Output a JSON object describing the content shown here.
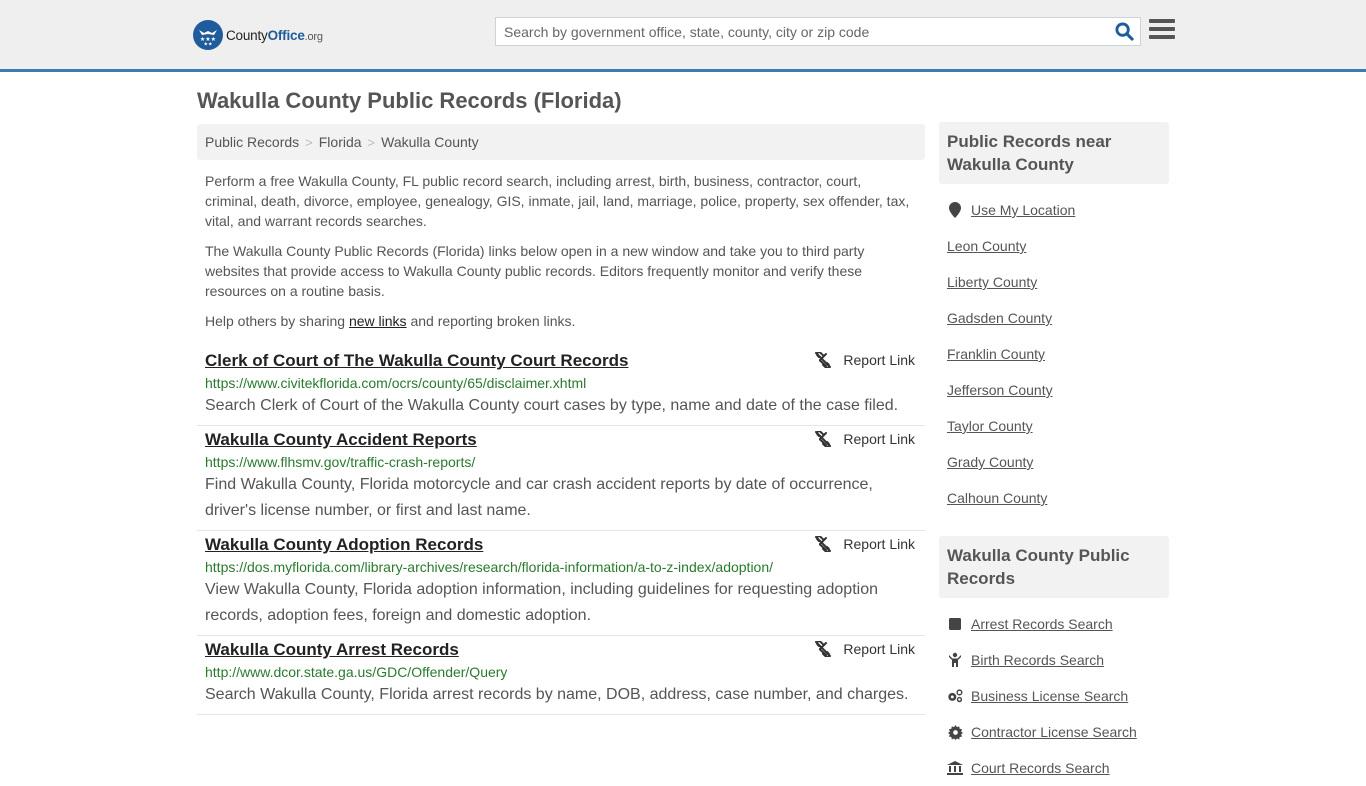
{
  "header": {
    "logo": {
      "name": "County",
      "office": "Office",
      "tld": ".org"
    },
    "search_placeholder": "Search by government office, state, county, city or zip code",
    "search_value": ""
  },
  "page": {
    "title": "Wakulla County Public Records (Florida)"
  },
  "breadcrumb": [
    "Public Records",
    "Florida",
    "Wakulla County"
  ],
  "intro": {
    "p1": "Perform a free Wakulla County, FL public record search, including arrest, birth, business, contractor, court, criminal, death, divorce, employee, genealogy, GIS, inmate, jail, land, marriage, police, property, sex offender, tax, vital, and warrant records searches.",
    "p2": "The Wakulla County Public Records (Florida) links below open in a new window and take you to third party websites that provide access to Wakulla County public records. Editors frequently monitor and verify these resources on a routine basis.",
    "p3_before": "Help others by sharing ",
    "p3_link": "new links",
    "p3_after": " and reporting broken links."
  },
  "report_label": "Report Link",
  "records": [
    {
      "title": "Clerk of Court of The Wakulla County Court Records",
      "url": "https://www.civitekflorida.com/ocrs/county/65/disclaimer.xhtml",
      "desc": "Search Clerk of Court of the Wakulla County court cases by type, name and date of the case filed."
    },
    {
      "title": "Wakulla County Accident Reports",
      "url": "https://www.flhsmv.gov/traffic-crash-reports/",
      "desc": "Find Wakulla County, Florida motorcycle and car crash accident reports by date of occurrence, driver's license number, or first and last name."
    },
    {
      "title": "Wakulla County Adoption Records",
      "url": "https://dos.myflorida.com/library-archives/research/florida-information/a-to-z-index/adoption/",
      "desc": "View Wakulla County, Florida adoption information, including guidelines for requesting adoption records, adoption fees, foreign and domestic adoption."
    },
    {
      "title": "Wakulla County Arrest Records",
      "url": "http://www.dcor.state.ga.us/GDC/Offender/Query",
      "desc": "Search Wakulla County, Florida arrest records by name, DOB, address, case number, and charges."
    }
  ],
  "sidebar": {
    "near_title": "Public Records near Wakulla County",
    "use_location": "Use My Location",
    "nearby": [
      "Leon County",
      "Liberty County",
      "Gadsden County",
      "Franklin County",
      "Jefferson County",
      "Taylor County",
      "Grady County",
      "Calhoun County"
    ],
    "public_title": "Wakulla County Public Records",
    "searches": [
      {
        "label": "Arrest Records Search",
        "icon": "square-icon"
      },
      {
        "label": "Birth Records Search",
        "icon": "child-icon"
      },
      {
        "label": "Business License Search",
        "icon": "gears-icon"
      },
      {
        "label": "Contractor License Search",
        "icon": "gear-icon"
      },
      {
        "label": "Court Records Search",
        "icon": "courthouse-icon"
      }
    ]
  },
  "colors": {
    "brand": "#1f5c9c",
    "accent_bar": "#3a7cb0",
    "url_green": "#2a7a2e"
  }
}
